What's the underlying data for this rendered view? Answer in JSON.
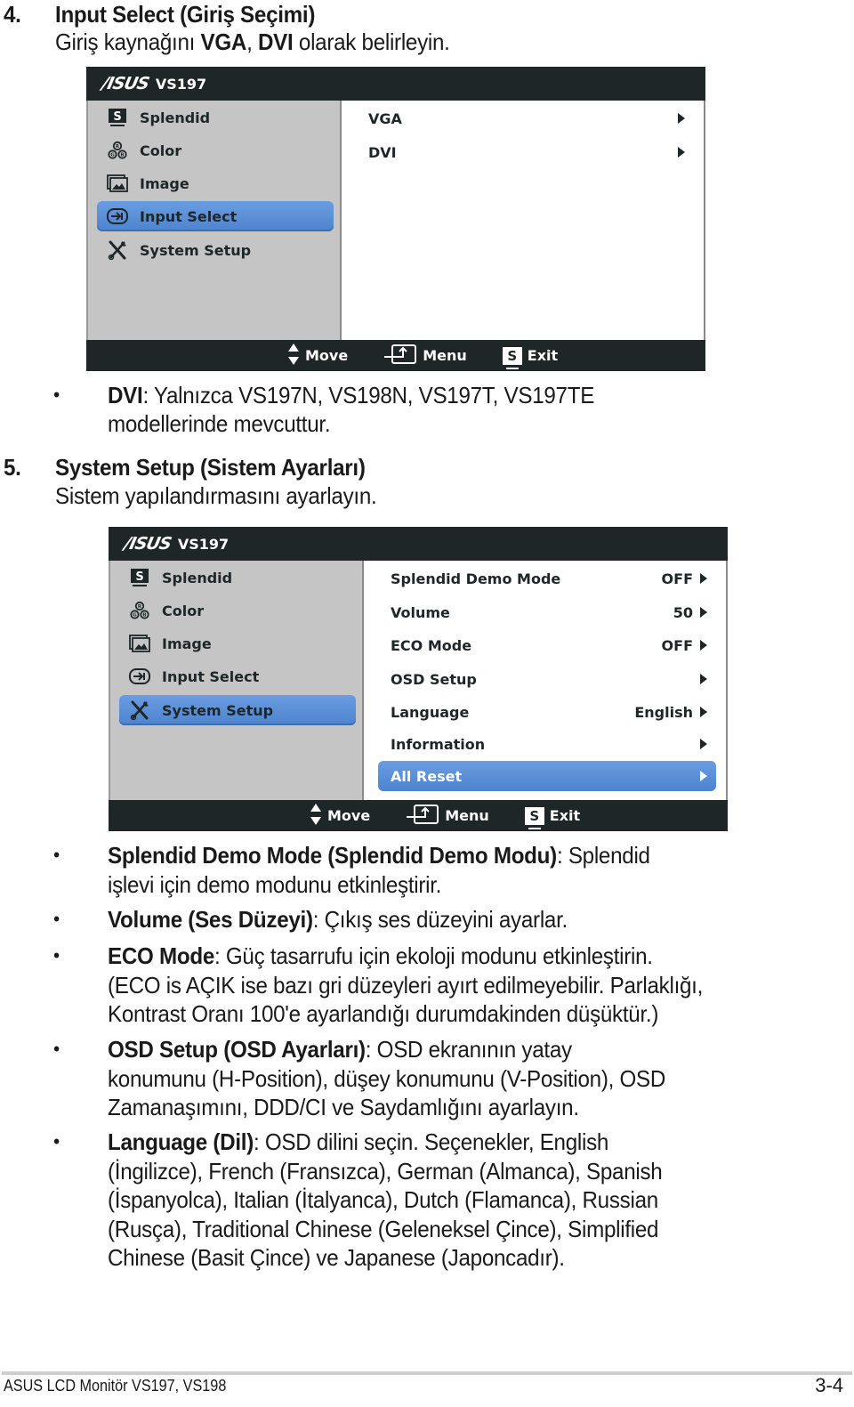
{
  "section4": {
    "number": "4.",
    "title": "Input Select (Giriş Seçimi)",
    "desc_pre": "Giriş kaynağını ",
    "desc_b1": "VGA",
    "desc_mid": ", ",
    "desc_b2": "DVI",
    "desc_post": " olarak belirleyin."
  },
  "osd1": {
    "brand": "/ISUS",
    "model": "VS197",
    "left_menu": [
      {
        "label": "Splendid",
        "icon": "splendid-icon",
        "selected": false
      },
      {
        "label": "Color",
        "icon": "color-rgb-icon",
        "selected": false
      },
      {
        "label": "Image",
        "icon": "image-icon",
        "selected": false
      },
      {
        "label": "Input Select",
        "icon": "input-select-icon",
        "selected": true
      },
      {
        "label": "System Setup",
        "icon": "tools-icon",
        "selected": false
      }
    ],
    "right_menu": [
      {
        "label": "VGA",
        "value": ""
      },
      {
        "label": "DVI",
        "value": ""
      }
    ],
    "footer": {
      "move": "Move",
      "menu": "Menu",
      "exit": "Exit",
      "exit_key": "S"
    }
  },
  "note_dvi": {
    "bullet": "•",
    "bold": "DVI",
    "text1": ": Yalnızca VS197N, VS198N, VS197T, VS197TE",
    "text2": "modellerinde mevcuttur."
  },
  "section5": {
    "number": "5.",
    "title": "System Setup (Sistem Ayarları)",
    "desc": "Sistem yapılandırmasını ayarlayın."
  },
  "osd2": {
    "brand": "/ISUS",
    "model": "VS197",
    "left_menu": [
      {
        "label": "Splendid",
        "icon": "splendid-icon",
        "selected": false
      },
      {
        "label": "Color",
        "icon": "color-rgb-icon",
        "selected": false
      },
      {
        "label": "Image",
        "icon": "image-icon",
        "selected": false
      },
      {
        "label": "Input Select",
        "icon": "input-select-icon",
        "selected": false
      },
      {
        "label": "System Setup",
        "icon": "tools-icon",
        "selected": true
      }
    ],
    "right_menu": [
      {
        "label": "Splendid Demo Mode",
        "value": "OFF"
      },
      {
        "label": "Volume",
        "value": "50"
      },
      {
        "label": "ECO Mode",
        "value": "OFF"
      },
      {
        "label": "OSD Setup",
        "value": ""
      },
      {
        "label": "Language",
        "value": "English"
      },
      {
        "label": "Information",
        "value": ""
      },
      {
        "label": "All Reset",
        "value": "",
        "selected": true
      }
    ],
    "footer": {
      "move": "Move",
      "menu": "Menu",
      "exit": "Exit",
      "exit_key": "S"
    }
  },
  "bullets": [
    {
      "bold": "Splendid Demo Mode (Splendid Demo Modu)",
      "lines": [
        ": Splendid",
        "işlevi için demo modunu etkinleştirir."
      ]
    },
    {
      "bold": "Volume (Ses Düzeyi)",
      "lines": [
        ": Çıkış ses düzeyini ayarlar."
      ]
    },
    {
      "bold": "ECO Mode",
      "lines": [
        ": Güç tasarrufu için ekoloji modunu etkinleştirin.",
        "(ECO is AÇIK ise bazı gri düzeyleri ayırt edilmeyebilir. Parlaklığı,",
        "Kontrast Oranı 100'e ayarlandığı durumdakinden düşüktür.)"
      ]
    },
    {
      "bold": "OSD Setup (OSD Ayarları)",
      "lines": [
        ": OSD ekranının yatay",
        "konumunu (H-Position), düşey konumunu (V-Position), OSD",
        "Zamanaşımını, DDD/CI ve Saydamlığını ayarlayın."
      ]
    },
    {
      "bold": "Language (Dil)",
      "lines": [
        ": OSD dilini seçin. Seçenekler, English",
        "(İngilizce), French (Fransızca), German (Almanca), Spanish",
        "(İspanyolca), Italian (İtalyanca), Dutch (Flamanca), Russian",
        "(Rusça), Traditional Chinese (Geleneksel Çince), Simplified",
        "Chinese (Basit Çince) ve Japanese (Japoncadır)."
      ]
    }
  ],
  "page_footer": {
    "left": "ASUS LCD Monitör VS197, VS198",
    "right": "3-4"
  }
}
